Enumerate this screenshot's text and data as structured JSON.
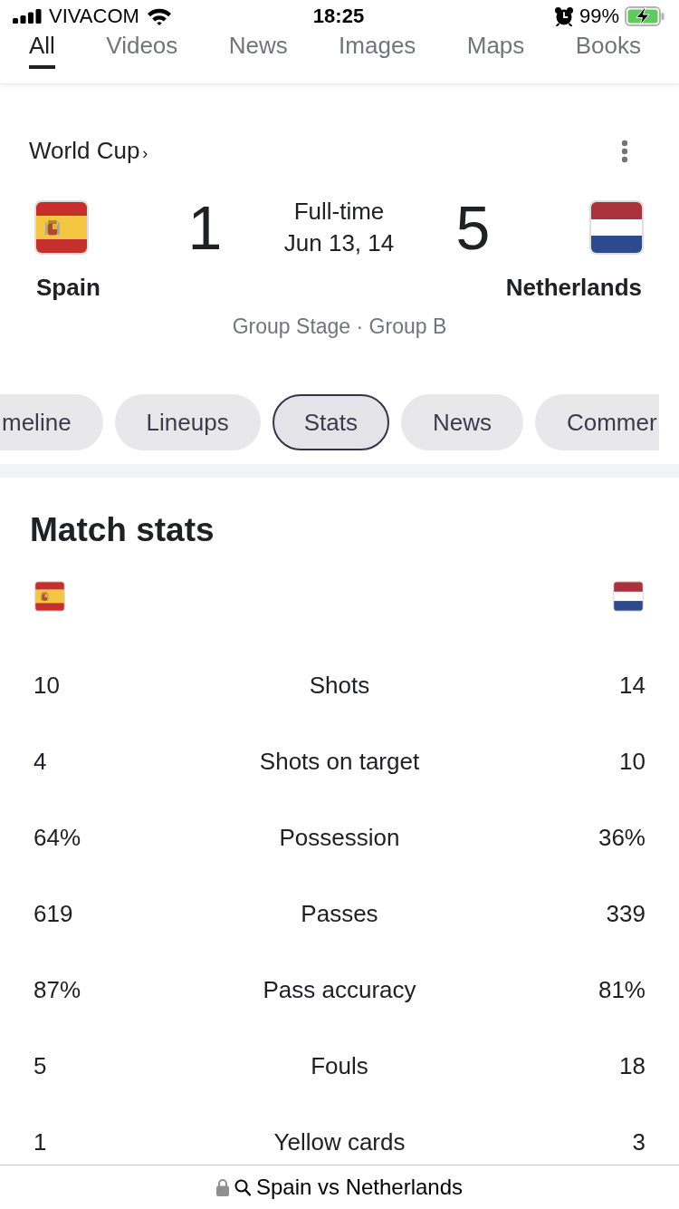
{
  "status_bar": {
    "carrier": "VIVACOM",
    "time": "18:25",
    "battery": "99%"
  },
  "search_tabs": [
    {
      "label": "All",
      "selected": true
    },
    {
      "label": "Videos",
      "selected": false
    },
    {
      "label": "News",
      "selected": false
    },
    {
      "label": "Images",
      "selected": false
    },
    {
      "label": "Maps",
      "selected": false
    },
    {
      "label": "Books",
      "selected": false
    }
  ],
  "match": {
    "competition": "World Cup",
    "chevron": "›",
    "status": "Full-time",
    "date": "Jun 13, 14",
    "stage": "Group Stage · Group B",
    "teams": [
      {
        "name": "Spain",
        "score": "1",
        "kind": "spain"
      },
      {
        "name": "Netherlands",
        "score": "5",
        "kind": "netherlands"
      }
    ]
  },
  "match_tabs": [
    {
      "label": "meline",
      "selected": false
    },
    {
      "label": "Lineups",
      "selected": false
    },
    {
      "label": "Stats",
      "selected": true
    },
    {
      "label": "News",
      "selected": false
    },
    {
      "label": "Commer",
      "selected": false
    }
  ],
  "match_stats": {
    "title": "Match stats",
    "rows": [
      {
        "home": "10",
        "label": "Shots",
        "away": "14"
      },
      {
        "home": "4",
        "label": "Shots on target",
        "away": "10"
      },
      {
        "home": "64%",
        "label": "Possession",
        "away": "36%"
      },
      {
        "home": "619",
        "label": "Passes",
        "away": "339"
      },
      {
        "home": "87%",
        "label": "Pass accuracy",
        "away": "81%"
      },
      {
        "home": "5",
        "label": "Fouls",
        "away": "18"
      },
      {
        "home": "1",
        "label": "Yellow cards",
        "away": "3"
      }
    ]
  },
  "address_bar": {
    "text": "Spain vs Netherlands"
  }
}
